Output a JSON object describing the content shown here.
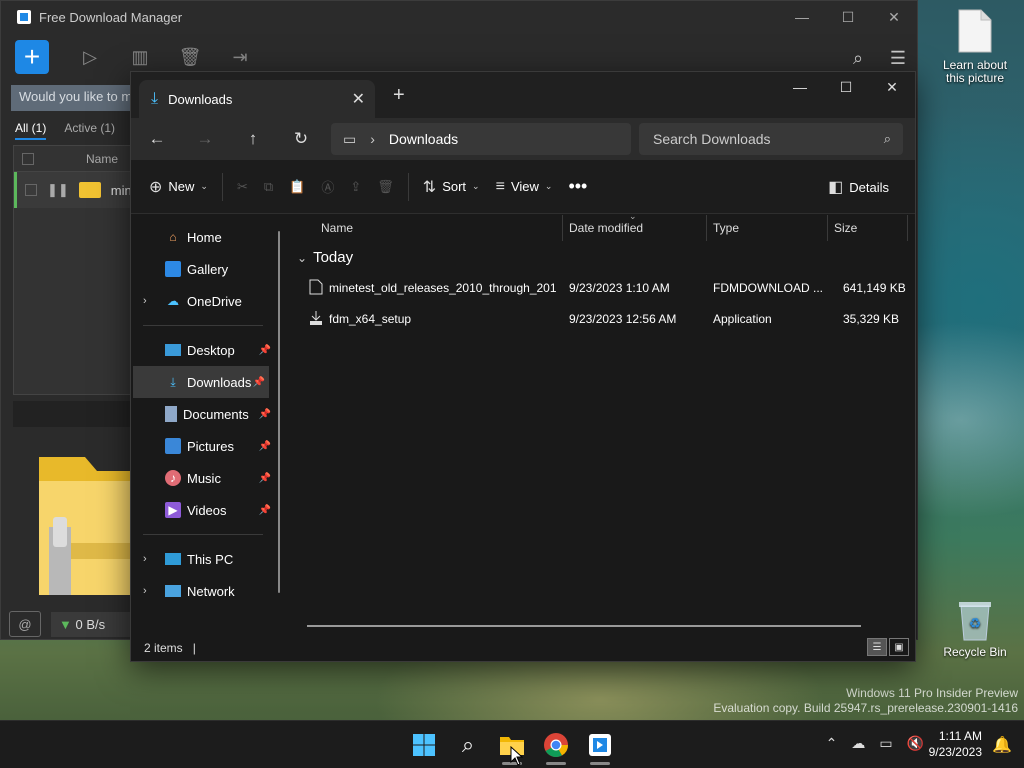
{
  "desktop": {
    "learn_label": "Learn about\nthis picture",
    "recycle_label": "Recycle Bin",
    "watermark_line1": "Windows 11 Pro Insider Preview",
    "watermark_line2": "Evaluation copy. Build 25947.rs_prerelease.230901-1416"
  },
  "fdm": {
    "title": "Free Download Manager",
    "banner": "Would you like to m",
    "tabs": [
      "All (1)",
      "Active (1)"
    ],
    "col_name": "Name",
    "row_name": "mine",
    "speed": "0 B/s"
  },
  "explorer": {
    "tab_title": "Downloads",
    "address": "Downloads",
    "search_placeholder": "Search Downloads",
    "cmd": {
      "new": "New",
      "sort": "Sort",
      "view": "View",
      "details": "Details"
    },
    "nav": {
      "home": "Home",
      "gallery": "Gallery",
      "onedrive": "OneDrive",
      "desktop": "Desktop",
      "downloads": "Downloads",
      "documents": "Documents",
      "pictures": "Pictures",
      "music": "Music",
      "videos": "Videos",
      "thispc": "This PC",
      "network": "Network"
    },
    "columns": {
      "name": "Name",
      "date": "Date modified",
      "type": "Type",
      "size": "Size"
    },
    "group": "Today",
    "files": [
      {
        "name": "minetest_old_releases_2010_through_201...",
        "date": "9/23/2023 1:10 AM",
        "type": "FDMDOWNLOAD ...",
        "size": "641,149 KB"
      },
      {
        "name": "fdm_x64_setup",
        "date": "9/23/2023 12:56 AM",
        "type": "Application",
        "size": "35,329 KB"
      }
    ],
    "status": "2 items"
  },
  "taskbar": {
    "time": "1:11 AM",
    "date": "9/23/2023"
  }
}
